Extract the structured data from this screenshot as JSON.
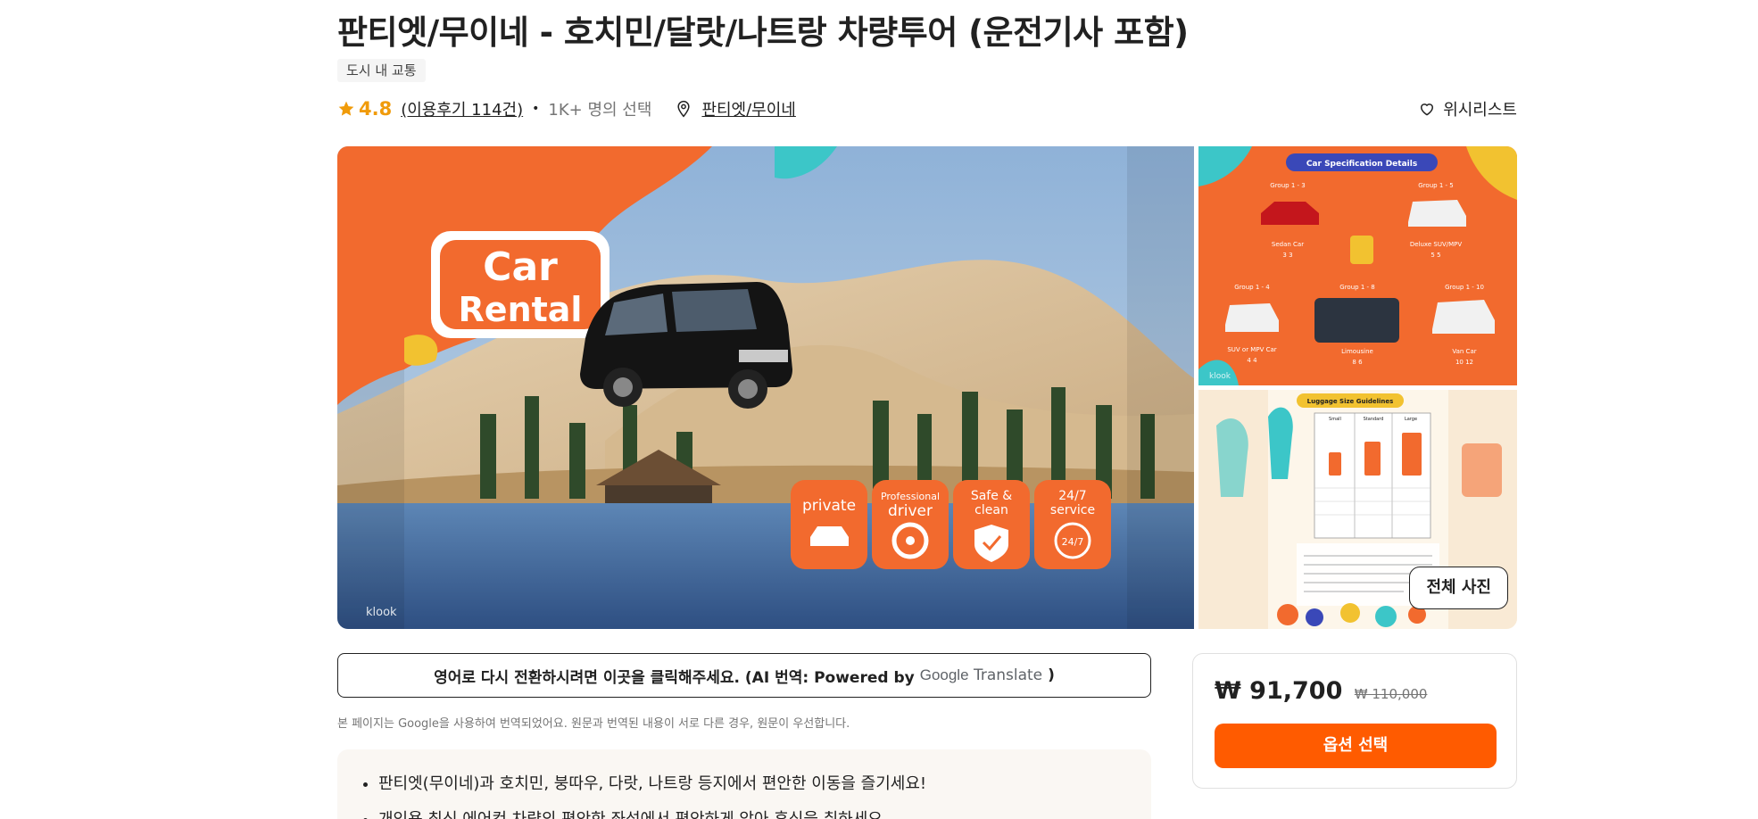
{
  "activity": {
    "title": "판티엣/무이네 - 호치민/달랏/나트랑 차량투어 (운전기사 포함)",
    "category_tag": "도시 내 교통",
    "rating": "4.8",
    "reviews_label": "(이용후기 114건)",
    "booked_label": "1K+ 명의 선택",
    "location": "판티엣/무이네",
    "wishlist_label": "위시리스트"
  },
  "gallery": {
    "main": {
      "headline_line1": "Car",
      "headline_line2": "Rental",
      "badges": [
        {
          "line1": "private",
          "line2": ""
        },
        {
          "line1": "Professional",
          "line2": "driver"
        },
        {
          "line1": "Safe &",
          "line2": "clean"
        },
        {
          "line1": "24/7",
          "line2": "service"
        }
      ],
      "badge_247": "24/7",
      "watermark": "klook"
    },
    "side_top": {
      "heading": "Car Specification Details",
      "cars": [
        {
          "group": "Group 1 - 3",
          "name": "Sedan Car",
          "specs": "3  3"
        },
        {
          "group": "Group 1 - 5",
          "name": "Deluxe SUV/MPV",
          "specs": "5  5"
        },
        {
          "group": "Group 1 - 4",
          "name": "SUV or MPV Car",
          "specs": "4  4"
        },
        {
          "group": "Group 1 - 8",
          "name": "Limousine",
          "specs": "8  6"
        },
        {
          "group": "Group 1 - 10",
          "name": "Van Car",
          "specs": "10  12"
        }
      ],
      "watermark": "klook"
    },
    "side_bottom": {
      "heading": "Luggage Size Guidelines",
      "columns": [
        "Small",
        "Standard",
        "Large"
      ]
    },
    "all_photos_label": "전체 사진"
  },
  "translation": {
    "button_text": "영어로 다시 전환하시려면 이곳을 클릭해주세요. (AI 번역: Powered by",
    "google": "Google",
    "translate": "Translate",
    "close_paren": ")",
    "notice": "본 페이지는 Google을 사용하여 번역되었어요. 원문과 번역된 내용이 서로 다른 경우, 원문이 우선합니다."
  },
  "description": {
    "bullets": [
      "판티엣(무이네)과 호치민, 붕따우, 다랏, 나트랑 등지에서 편안한 이동을 즐기세요!",
      "개인용 최신 에어컨 차량의 편안한 좌석에서 편안하게 앉아 휴식을 취하세요"
    ]
  },
  "booking": {
    "price": "₩ 91,700",
    "original_price": "₩ 110,000",
    "select_label": "옵션 선택"
  },
  "colors": {
    "brand_orange": "#ff5b00",
    "star": "#f09b0a",
    "badge_orange": "#f26a2e",
    "teal": "#3cc6c8"
  }
}
